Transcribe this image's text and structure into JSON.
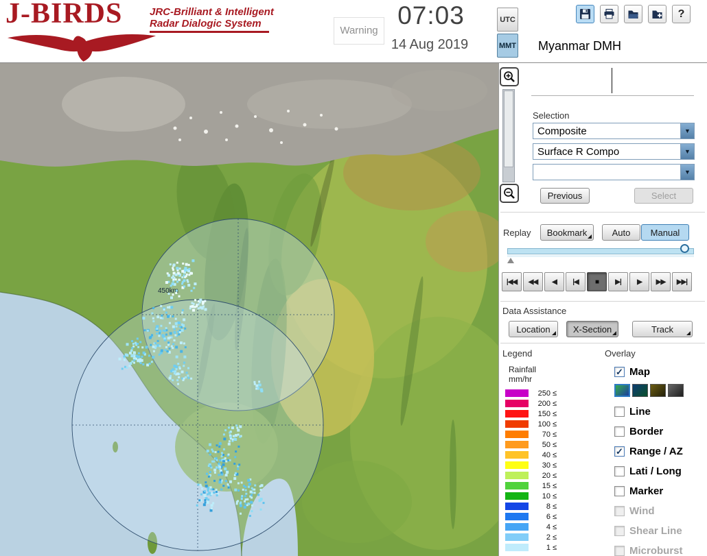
{
  "header": {
    "logo_title": "J-BIRDS",
    "logo_tagline1": "JRC-Brilliant & Intelligent",
    "logo_tagline2": "Radar Dialogic System",
    "warning": "Warning",
    "time": "07:03",
    "date": "14 Aug 2019",
    "utc": "UTC",
    "mmt": "MMT",
    "org": "Myanmar DMH",
    "toolbar_icons": [
      "save",
      "print",
      "open",
      "export",
      "help"
    ],
    "help_glyph": "?"
  },
  "selection": {
    "label": "Selection",
    "combo1": "Composite",
    "combo2": "Surface R Compo",
    "combo3": "",
    "previous": "Previous",
    "select": "Select",
    "chevron": "▼"
  },
  "replay": {
    "label": "Replay",
    "bookmark": "Bookmark",
    "auto": "Auto",
    "manual": "Manual",
    "playback": [
      "|◀◀",
      "◀◀",
      "◀",
      "|◀",
      "■",
      "▶|",
      "▶",
      "▶▶",
      "▶▶|"
    ]
  },
  "data_assistance": {
    "label": "Data Assistance",
    "location": "Location",
    "xsection": "X-Section",
    "track": "Track"
  },
  "legend": {
    "label": "Legend",
    "unit_line1": "Rainfall",
    "unit_line2": "mm/hr",
    "lte": "≤",
    "items": [
      {
        "value": "250",
        "color": "#c800c8"
      },
      {
        "value": "200",
        "color": "#e60064"
      },
      {
        "value": "150",
        "color": "#ff1414"
      },
      {
        "value": "100",
        "color": "#f03c00"
      },
      {
        "value": "70",
        "color": "#ff7d00"
      },
      {
        "value": "50",
        "color": "#ff9b1e"
      },
      {
        "value": "40",
        "color": "#ffc328"
      },
      {
        "value": "30",
        "color": "#ffff14"
      },
      {
        "value": "20",
        "color": "#bef05a"
      },
      {
        "value": "15",
        "color": "#50d23c"
      },
      {
        "value": "10",
        "color": "#14b414"
      },
      {
        "value": "8",
        "color": "#1446e6"
      },
      {
        "value": "6",
        "color": "#1e78f0"
      },
      {
        "value": "4",
        "color": "#46a5f5"
      },
      {
        "value": "2",
        "color": "#82cdf8"
      },
      {
        "value": "1",
        "color": "#c0ecfc"
      }
    ]
  },
  "overlay": {
    "label": "Overlay",
    "items": [
      {
        "label": "Map",
        "checked": true,
        "enabled": true
      },
      {
        "label": "Line",
        "checked": false,
        "enabled": true
      },
      {
        "label": "Border",
        "checked": false,
        "enabled": true
      },
      {
        "label": "Range / AZ",
        "checked": true,
        "enabled": true
      },
      {
        "label": "Lati / Long",
        "checked": false,
        "enabled": true
      },
      {
        "label": "Marker",
        "checked": false,
        "enabled": true
      },
      {
        "label": "Wind",
        "checked": false,
        "enabled": false
      },
      {
        "label": "Shear Line",
        "checked": false,
        "enabled": false
      },
      {
        "label": "Microburst",
        "checked": false,
        "enabled": false
      }
    ],
    "map_styles": [
      {
        "name": "green-blue",
        "from": "#35a94f",
        "to": "#1c3f9e",
        "selected": true
      },
      {
        "name": "navy-green",
        "from": "#0d3c72",
        "to": "#0a4f2a",
        "selected": false
      },
      {
        "name": "olive-dark",
        "from": "#6b5c12",
        "to": "#23200a",
        "selected": false
      },
      {
        "name": "gray-dark",
        "from": "#676767",
        "to": "#1e1e1e",
        "selected": false
      }
    ]
  },
  "map": {
    "range_label": "450km"
  }
}
